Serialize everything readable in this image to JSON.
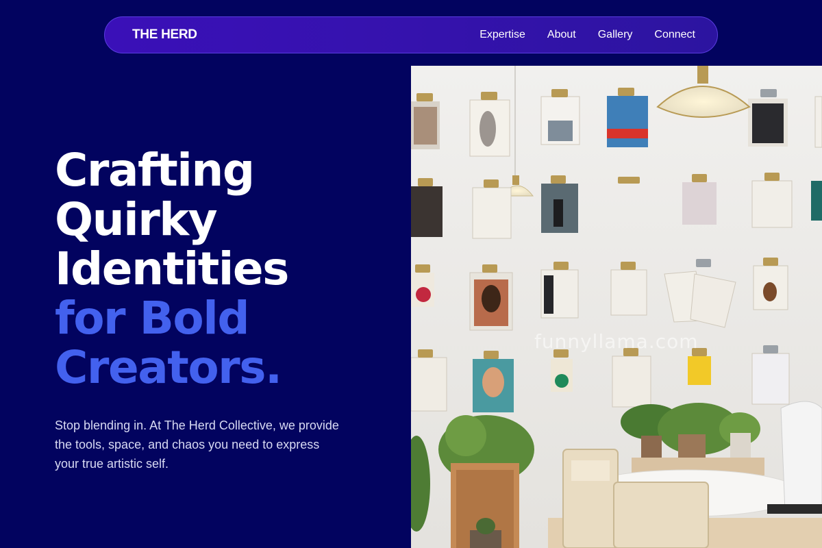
{
  "nav": {
    "brand": "THE HERD",
    "links": [
      "Expertise",
      "About",
      "Gallery",
      "Connect"
    ]
  },
  "hero": {
    "line1": "Crafting",
    "line2": "Quirky",
    "line3": "Identities",
    "line4": "for Bold",
    "line5": "Creators.",
    "subtitle": "Stop blending in. At The Herd Collective, we provide the tools, space, and chaos you need to express your true artistic self."
  },
  "image": {
    "watermark": "funnyllama.com"
  },
  "colors": {
    "background": "#02035f",
    "nav": "#3a10b8",
    "accent": "#4361ee"
  }
}
